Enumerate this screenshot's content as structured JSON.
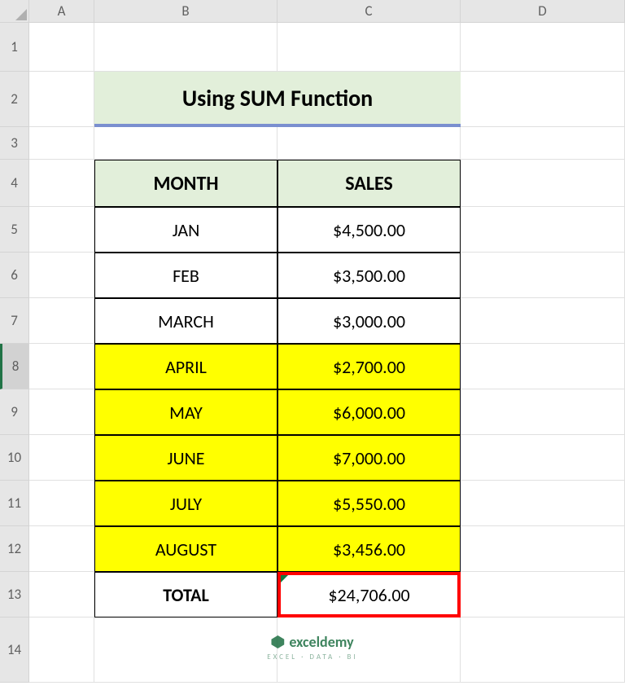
{
  "columns": [
    "A",
    "B",
    "C",
    "D"
  ],
  "rows": [
    "1",
    "2",
    "3",
    "4",
    "5",
    "6",
    "7",
    "8",
    "9",
    "10",
    "11",
    "12",
    "13",
    "14"
  ],
  "title": "Using SUM Function",
  "headers": {
    "month": "MONTH",
    "sales": "SALES"
  },
  "data": [
    {
      "month": "JAN",
      "sales": "$4,500.00",
      "hl": false
    },
    {
      "month": "FEB",
      "sales": "$3,500.00",
      "hl": false
    },
    {
      "month": "MARCH",
      "sales": "$3,000.00",
      "hl": false
    },
    {
      "month": "APRIL",
      "sales": "$2,700.00",
      "hl": true
    },
    {
      "month": "MAY",
      "sales": "$6,000.00",
      "hl": true
    },
    {
      "month": "JUNE",
      "sales": "$7,000.00",
      "hl": true
    },
    {
      "month": "JULY",
      "sales": "$5,550.00",
      "hl": true
    },
    {
      "month": "AUGUST",
      "sales": "$3,456.00",
      "hl": true
    }
  ],
  "total": {
    "label": "TOTAL",
    "value": "$24,706.00"
  },
  "selected_row": "8",
  "watermark": {
    "brand": "exceldemy",
    "tagline": "EXCEL · DATA · BI"
  }
}
